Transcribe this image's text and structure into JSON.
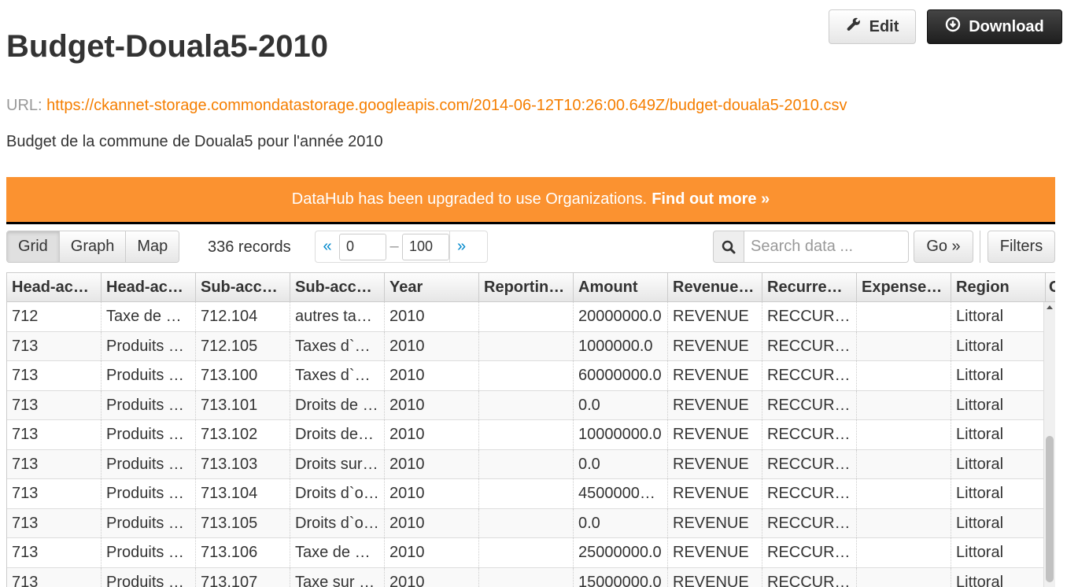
{
  "title": "Budget-Douala5-2010",
  "actions": {
    "edit_label": "Edit",
    "download_label": "Download"
  },
  "url_label": "URL:",
  "url_link": "https://ckannet-storage.commondatastorage.googleapis.com/2014-06-12T10:26:00.649Z/budget-douala5-2010.csv",
  "description": "Budget de la commune de Douala5 pour l'année 2010",
  "banner": {
    "text": "DataHub has been upgraded to use Organizations.",
    "link": "Find out more »"
  },
  "toolbar": {
    "views": [
      "Grid",
      "Graph",
      "Map"
    ],
    "active_view": "Grid",
    "records": "336 records",
    "pager": {
      "prev": "«",
      "from": "0",
      "dash": "–",
      "to": "100",
      "next": "»"
    },
    "search_placeholder": "Search data ...",
    "go_label": "Go »",
    "filters_label": "Filters"
  },
  "grid": {
    "columns": [
      "Head-ac…",
      "Head-ac…",
      "Sub-acc…",
      "Sub-acc…",
      "Year",
      "Reportin…",
      "Amount",
      "Revenue…",
      "Recurre…",
      "Expense…",
      "Region",
      "C"
    ],
    "rows": [
      [
        "712",
        "Taxe de …",
        "712.104",
        "autres ta…",
        "2010",
        "",
        "20000000.0",
        "REVENUE",
        "RECCUR…",
        "",
        "Littoral"
      ],
      [
        "713",
        "Produits …",
        "712.105",
        "Taxes d`…",
        "2010",
        "",
        "1000000.0",
        "REVENUE",
        "RECCUR…",
        "",
        "Littoral"
      ],
      [
        "713",
        "Produits …",
        "713.100",
        "Taxes d`…",
        "2010",
        "",
        "60000000.0",
        "REVENUE",
        "RECCUR…",
        "",
        "Littoral"
      ],
      [
        "713",
        "Produits …",
        "713.101",
        "Droits de …",
        "2010",
        "",
        "0.0",
        "REVENUE",
        "RECCUR…",
        "",
        "Littoral"
      ],
      [
        "713",
        "Produits …",
        "713.102",
        "Droits de…",
        "2010",
        "",
        "10000000.0",
        "REVENUE",
        "RECCUR…",
        "",
        "Littoral"
      ],
      [
        "713",
        "Produits …",
        "713.103",
        "Droits sur…",
        "2010",
        "",
        "0.0",
        "REVENUE",
        "RECCUR…",
        "",
        "Littoral"
      ],
      [
        "713",
        "Produits …",
        "713.104",
        "Droits d`o…",
        "2010",
        "",
        "4500000…",
        "REVENUE",
        "RECCUR…",
        "",
        "Littoral"
      ],
      [
        "713",
        "Produits …",
        "713.105",
        "Droits d`o…",
        "2010",
        "",
        "0.0",
        "REVENUE",
        "RECCUR…",
        "",
        "Littoral"
      ],
      [
        "713",
        "Produits …",
        "713.106",
        "Taxe de …",
        "2010",
        "",
        "25000000.0",
        "REVENUE",
        "RECCUR…",
        "",
        "Littoral"
      ],
      [
        "713",
        "Produits …",
        "713.107",
        "Taxe sur …",
        "2010",
        "",
        "15000000.0",
        "REVENUE",
        "RECCUR…",
        "",
        "Littoral"
      ]
    ]
  }
}
